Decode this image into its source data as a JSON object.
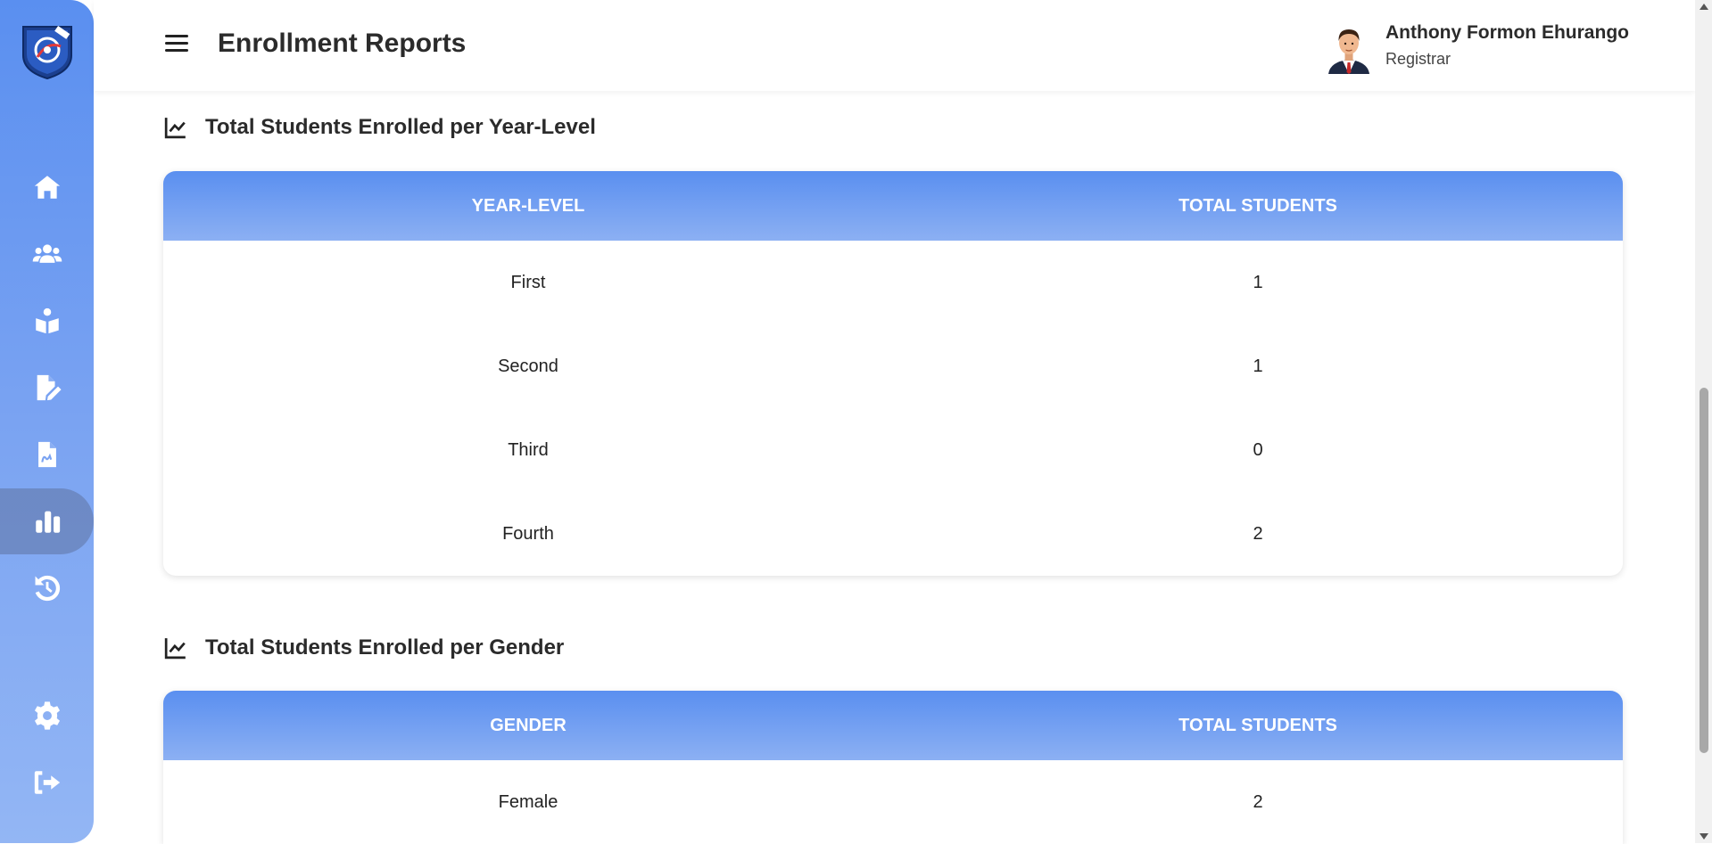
{
  "header": {
    "title": "Enrollment Reports",
    "user": {
      "name": "Anthony Formon Ehurango",
      "role": "Registrar"
    }
  },
  "sidebar": {
    "items": [
      {
        "icon": "home-icon",
        "active": false
      },
      {
        "icon": "users-icon",
        "active": false
      },
      {
        "icon": "student-reading-icon",
        "active": false
      },
      {
        "icon": "file-edit-icon",
        "active": false
      },
      {
        "icon": "file-signature-icon",
        "active": false
      },
      {
        "icon": "bar-chart-icon",
        "active": true
      },
      {
        "icon": "history-icon",
        "active": false
      },
      {
        "icon": "gear-icon",
        "active": false
      },
      {
        "icon": "logout-icon",
        "active": false
      }
    ]
  },
  "sections": [
    {
      "title": "Total Students Enrolled per Year-Level",
      "columns": [
        "YEAR-LEVEL",
        "TOTAL STUDENTS"
      ],
      "rows": [
        [
          "First",
          "1"
        ],
        [
          "Second",
          "1"
        ],
        [
          "Third",
          "0"
        ],
        [
          "Fourth",
          "2"
        ]
      ]
    },
    {
      "title": "Total Students Enrolled per Gender",
      "columns": [
        "GENDER",
        "TOTAL STUDENTS"
      ],
      "rows": [
        [
          "Female",
          "2"
        ]
      ]
    }
  ],
  "colors": {
    "accent": "#5a8ff0",
    "accent_light": "#93b6f4",
    "text": "#2b2b2b"
  }
}
